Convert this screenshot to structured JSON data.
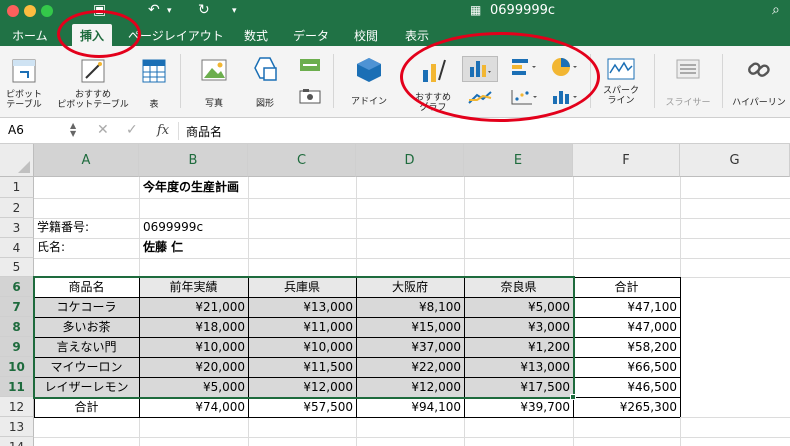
{
  "window": {
    "title": "0699999c"
  },
  "colors": {
    "accent": "#207245",
    "annotation": "#e3001b"
  },
  "tabs": [
    {
      "label": "ホーム"
    },
    {
      "label": "挿入"
    },
    {
      "label": "ページレイアウト"
    },
    {
      "label": "数式"
    },
    {
      "label": "データ"
    },
    {
      "label": "校閲"
    },
    {
      "label": "表示"
    }
  ],
  "ribbon": {
    "pivot_label": "ピボット\nテーブル",
    "rec_pivot_label": "おすすめ\nピボットテーブル",
    "table_label": "表",
    "photo_label": "写真",
    "shape_label": "図形",
    "addin_label": "アドイン",
    "rec_chart_label": "おすすめ\nグラフ",
    "sparkline_label": "スパーク\nライン",
    "slicer_label": "スライサー",
    "hyperlink_label": "ハイパーリン"
  },
  "formula_bar": {
    "cell_ref": "A6",
    "fx": "fx",
    "content": "商品名"
  },
  "columns": [
    "A",
    "B",
    "C",
    "D",
    "E",
    "F",
    "G"
  ],
  "rows": [
    "1",
    "2",
    "3",
    "4",
    "5",
    "6",
    "7",
    "8",
    "9",
    "10",
    "11",
    "12",
    "13",
    "14"
  ],
  "sheet": {
    "title": "今年度の生産計画",
    "student_label": "学籍番号:",
    "student_id": "0699999c",
    "name_label": "氏名:",
    "name": "佐藤 仁",
    "headers": [
      "商品名",
      "前年実績",
      "兵庫県",
      "大阪府",
      "奈良県",
      "合計"
    ],
    "data": [
      [
        "コケコーラ",
        "¥21,000",
        "¥13,000",
        "¥8,100",
        "¥5,000",
        "¥47,100"
      ],
      [
        "多いお茶",
        "¥18,000",
        "¥11,000",
        "¥15,000",
        "¥3,000",
        "¥47,000"
      ],
      [
        "言えない門",
        "¥10,000",
        "¥10,000",
        "¥37,000",
        "¥1,200",
        "¥58,200"
      ],
      [
        "マイウーロン",
        "¥20,000",
        "¥11,500",
        "¥22,000",
        "¥13,000",
        "¥66,500"
      ],
      [
        "レイザーレモン",
        "¥5,000",
        "¥12,000",
        "¥12,000",
        "¥17,500",
        "¥46,500"
      ]
    ],
    "total": [
      "合計",
      "¥74,000",
      "¥57,500",
      "¥94,100",
      "¥39,700",
      "¥265,300"
    ]
  }
}
